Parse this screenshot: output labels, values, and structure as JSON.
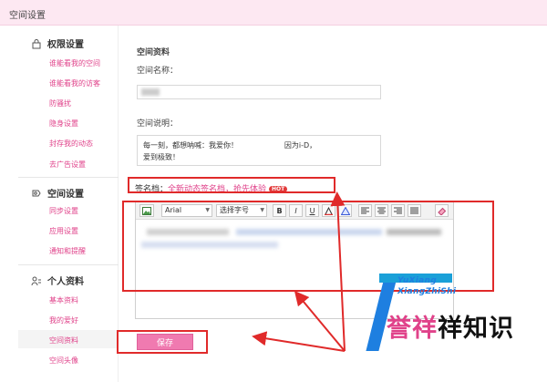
{
  "header": {
    "title": "空间设置"
  },
  "sidebar": {
    "sections": [
      {
        "title": "权限设置",
        "icon": "lock-icon",
        "items": [
          "谁能看我的空间",
          "谁能看我的访客",
          "防骚扰",
          "隐身设置",
          "封存我的动态",
          "去广告设置"
        ]
      },
      {
        "title": "空间设置",
        "icon": "settings-icon",
        "items": [
          "同步设置",
          "应用设置",
          "通知和提醒"
        ]
      },
      {
        "title": "个人资料",
        "icon": "person-icon",
        "items": [
          "基本资料",
          "我的爱好",
          "空间资料",
          "空间头像"
        ]
      }
    ],
    "active": "空间资料"
  },
  "form": {
    "section_title": "空间资料",
    "name_label": "空间名称：",
    "desc_label": "空间说明：",
    "desc_line1": "每一刻，都想呐喊：我爱你！                    因为i-D，",
    "desc_line2": "爱到极致！",
    "sig_label": "签名档：",
    "sig_link": "全新动态签名档，抢先体验",
    "sig_badge": "HOT",
    "save_label": "保存"
  },
  "editor": {
    "font": "Arial",
    "size_placeholder": "选择字号",
    "bold": "B",
    "italic": "I",
    "underline": "U"
  },
  "watermark": {
    "en_line1": "YuXiang",
    "en_line2": "XiangZhiShi",
    "zh_prefix": "誉",
    "zh_mid": "祥",
    "zh_rest": "祥知识"
  },
  "colors": {
    "accent": "#e0428a",
    "button": "#f07ab0",
    "header_bg": "#fde8f2",
    "annotation": "#e02a2a"
  }
}
